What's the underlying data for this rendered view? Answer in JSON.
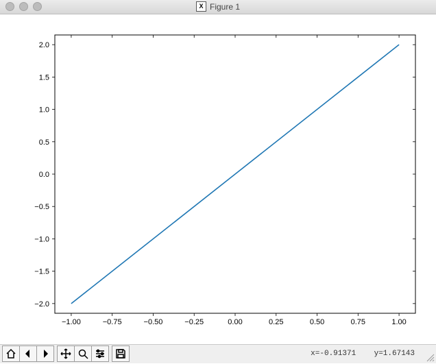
{
  "window": {
    "title": "Figure 1",
    "app_icon_label": "X"
  },
  "chart_data": {
    "type": "line",
    "x": [
      -1,
      1
    ],
    "y": [
      -2,
      2
    ],
    "xlim": [
      -1.1,
      1.1
    ],
    "ylim": [
      -2.15,
      2.15
    ],
    "xticks": [
      "−1.00",
      "−0.75",
      "−0.50",
      "−0.25",
      "0.00",
      "0.25",
      "0.50",
      "0.75",
      "1.00"
    ],
    "xtick_values": [
      -1.0,
      -0.75,
      -0.5,
      -0.25,
      0.0,
      0.25,
      0.5,
      0.75,
      1.0
    ],
    "yticks": [
      "−2.0",
      "−1.5",
      "−1.0",
      "−0.5",
      "0.0",
      "0.5",
      "1.0",
      "1.5",
      "2.0"
    ],
    "ytick_values": [
      -2.0,
      -1.5,
      -1.0,
      -0.5,
      0.0,
      0.5,
      1.0,
      1.5,
      2.0
    ],
    "title": "",
    "xlabel": "",
    "ylabel": ""
  },
  "toolbar": {
    "home": "Home",
    "back": "Back",
    "forward": "Forward",
    "pan": "Pan",
    "zoom": "Zoom",
    "configure": "Configure subplots",
    "save": "Save"
  },
  "status": {
    "coords": "x=-0.91371    y=1.67143"
  }
}
